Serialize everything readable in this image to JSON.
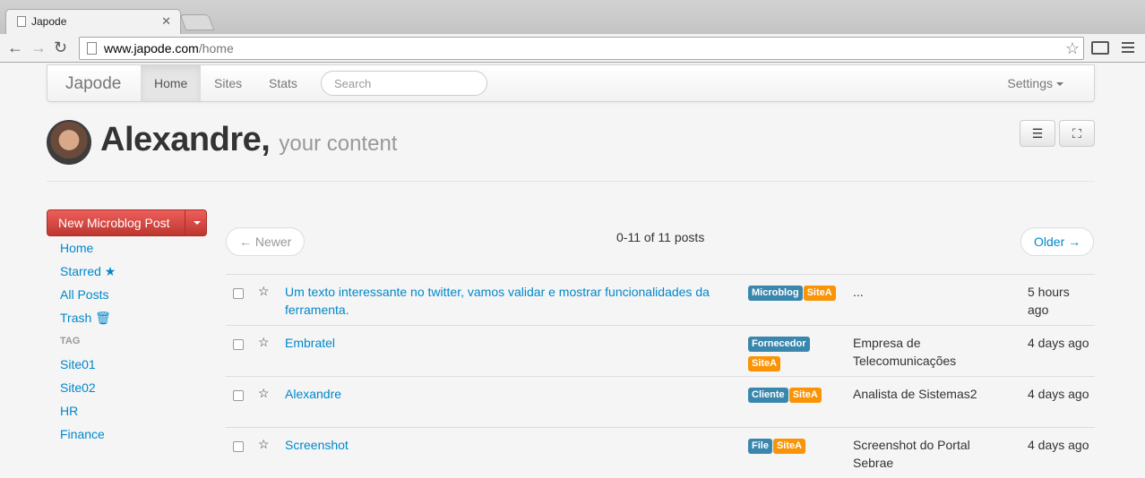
{
  "browser": {
    "tab_title": "Japode",
    "url_host": "www.japode.com",
    "url_path": "/home"
  },
  "navbar": {
    "brand": "Japode",
    "links": [
      "Home",
      "Sites",
      "Stats"
    ],
    "active": "Home",
    "search_placeholder": "Search",
    "settings": "Settings"
  },
  "header": {
    "name": "Alexandre,",
    "subtitle": "your content"
  },
  "sidebar": {
    "new_post_button": "New Microblog Post",
    "items": [
      "Home",
      "Starred ★",
      "All Posts",
      "Trash 🗑"
    ],
    "tag_header": "TAG",
    "tags": [
      "Site01",
      "Site02",
      "HR",
      "Finance"
    ]
  },
  "pager": {
    "newer": "← Newer",
    "older": "Older →",
    "count": "0-11 of 11 posts"
  },
  "posts": [
    {
      "title": "Um texto interessante no twitter, vamos validar e mostrar funcionalidades da ferramenta.",
      "labels": [
        {
          "text": "Microblog",
          "color": "blue"
        },
        {
          "text": "SiteA",
          "color": "orange"
        }
      ],
      "description": "...",
      "time": "5 hours ago"
    },
    {
      "title": "Embratel",
      "labels": [
        {
          "text": "Fornecedor",
          "color": "blue"
        },
        {
          "text": "SiteA",
          "color": "orange"
        }
      ],
      "description": "Empresa de Telecomunicações",
      "time": "4 days ago"
    },
    {
      "title": "Alexandre",
      "labels": [
        {
          "text": "Cliente",
          "color": "blue"
        },
        {
          "text": "SiteA",
          "color": "orange"
        }
      ],
      "description": "Analista de Sistemas2",
      "time": "4 days ago"
    },
    {
      "title": "Screenshot",
      "labels": [
        {
          "text": "File",
          "color": "blue"
        },
        {
          "text": "SiteA",
          "color": "orange"
        }
      ],
      "description": "Screenshot do Portal Sebrae",
      "time": "4 days ago"
    }
  ],
  "colors": {
    "link": "#0088cc",
    "danger": "#da4f49",
    "label_blue": "#3a87ad",
    "label_orange": "#f89406"
  }
}
